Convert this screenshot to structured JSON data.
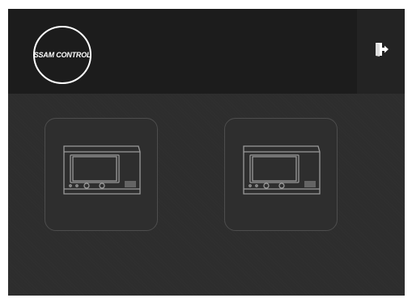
{
  "header": {
    "logo_text": "SSAM CONTROL",
    "exit_icon": "exit-door-icon"
  },
  "devices": [
    {
      "icon": "control-panel-device-icon"
    },
    {
      "icon": "control-panel-device-icon"
    }
  ],
  "colors": {
    "header_bg": "#1c1c1c",
    "exit_bg": "#232323",
    "body_bg": "#2d2d2d",
    "tile_border": "#4d4d4d",
    "icon_stroke": "#9a9a9a"
  }
}
